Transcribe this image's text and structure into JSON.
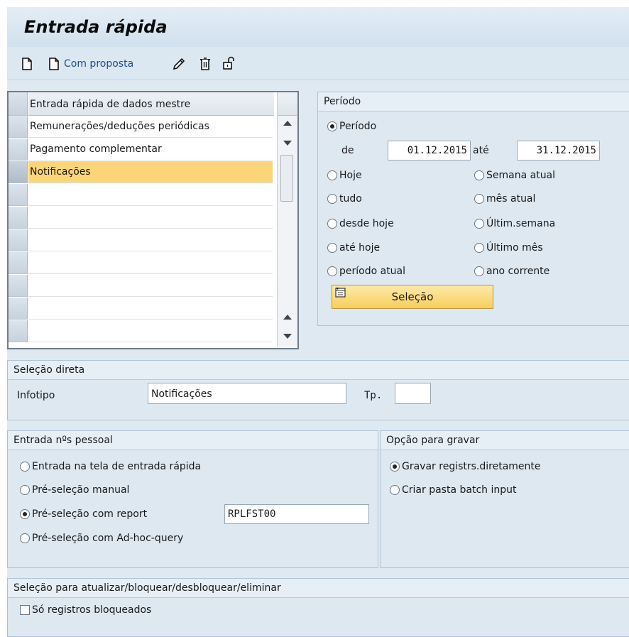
{
  "title": "Entrada rápida",
  "toolbar": {
    "com_proposta": "Com proposta",
    "icons": [
      "new-document-icon",
      "document-with-proposal-icon",
      "pencil-icon",
      "trash-icon",
      "lock-icon"
    ]
  },
  "table": {
    "header": "Entrada rápida de dados mestre",
    "rows": [
      "Remunerações/deduções periódicas",
      "Pagamento complementar",
      "Notificações",
      "",
      "",
      "",
      "",
      "",
      "",
      "",
      ""
    ],
    "selected_row": 2
  },
  "periodo": {
    "group_title": "Período",
    "periodo_label": "Período",
    "de_label": "de",
    "ate_label": "até",
    "from_date": "01.12.2015",
    "to_date": "31.12.2015",
    "options_left": [
      "Hoje",
      "tudo",
      "desde hoje",
      "até hoje",
      "período atual"
    ],
    "options_right": [
      "Semana atual",
      "mês atual",
      "Últim.semana",
      "Último mês",
      "ano corrente"
    ],
    "selecao_button": "Seleção"
  },
  "selecao_direta": {
    "group_title": "Seleção direta",
    "infotipo_label": "Infotipo",
    "infotipo_value": "Notificações",
    "tp_label": "Tp.",
    "tp_value": ""
  },
  "entrada_pessoal": {
    "group_title": "Entrada nºs pessoal",
    "options": [
      "Entrada na tela de entrada rápida",
      "Pré-seleção manual",
      "Pré-seleção com report",
      "Pré-seleção com Ad-hoc-query"
    ],
    "selected": 2,
    "report_value": "RPLFST00"
  },
  "gravar": {
    "group_title": "Opção para gravar",
    "options": [
      "Gravar registrs.diretamente",
      "Criar pasta batch input"
    ],
    "selected": 0
  },
  "atualizar": {
    "group_title": "Seleção para atualizar/bloquear/desbloquear/eliminar",
    "checkbox_label": "Só registros bloqueados",
    "checked": false
  },
  "colors": {
    "highlight": "#fbd576",
    "title_bar": "#d9e6f1",
    "panel": "#dde8f1",
    "link_text": "#1f4f8a"
  }
}
